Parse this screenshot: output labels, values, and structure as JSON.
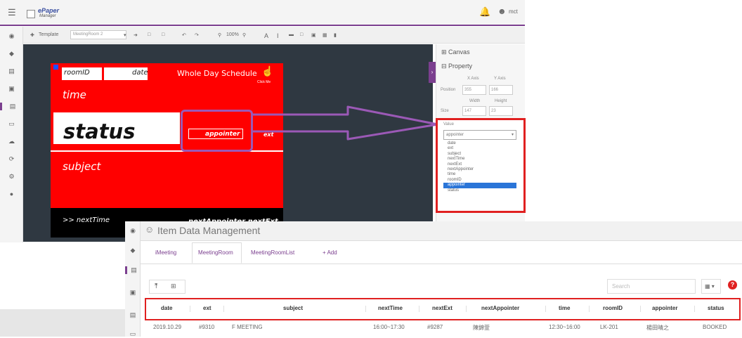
{
  "app": {
    "logo_text": "ePaper",
    "logo_subtext": "Manager",
    "user": "mct",
    "brand_color": "#7b3f8f"
  },
  "sidebar": {
    "icons": [
      "dashboard-icon",
      "tag-icon",
      "list-icon",
      "image-icon",
      "layout-icon",
      "monitor-icon",
      "cloud-icon",
      "refresh-icon",
      "settings-icon",
      "user-icon"
    ]
  },
  "toolbar": {
    "template_label": "Template",
    "template_value": "MeetingRoom 2",
    "zoom": "100%"
  },
  "canvas": {
    "fields": {
      "roomid": "roomID",
      "date": "date",
      "title": "Whole Day Schedule",
      "click_me": "Click Me",
      "time": "time",
      "status": "status",
      "appointer": "appointer",
      "ext": "ext",
      "subject": "subject",
      "next_time": ">>  nextTime",
      "next_appointer": "nextAppointer nextExt"
    }
  },
  "right_panel": {
    "canvas_label": "Canvas",
    "property_label": "Property",
    "x_axis": "X Axis",
    "y_axis": "Y Axis",
    "position_label": "Position",
    "pos_x": "355",
    "pos_y": "166",
    "width_label": "Width",
    "height_label": "Height",
    "size_label": "Size",
    "size_w": "147",
    "size_h": "23",
    "value_label": "Value",
    "value_selected": "appointer",
    "value_options": [
      "date",
      "ext",
      "subject",
      "nextTime",
      "nextExt",
      "nextAppointer",
      "time",
      "roomID",
      "appointer",
      "status"
    ]
  },
  "data_management": {
    "title": "Item Data Management",
    "tabs": [
      "iMeeting",
      "MeetingRoom",
      "MeetingRoomList",
      "+ Add"
    ],
    "active_tab": "MeetingRoom",
    "search_placeholder": "Search",
    "columns": [
      "date",
      "ext",
      "subject",
      "nextTime",
      "nextExt",
      "nextAppointer",
      "time",
      "roomID",
      "appointer",
      "status"
    ],
    "rows": [
      [
        "2019.10.29",
        "#9310",
        "F MEETING",
        "16:00~17:30",
        "#9287",
        "陳錦萱",
        "12:30~16:00",
        "LK-201",
        "楊田晴之",
        "BOOKED"
      ]
    ]
  }
}
